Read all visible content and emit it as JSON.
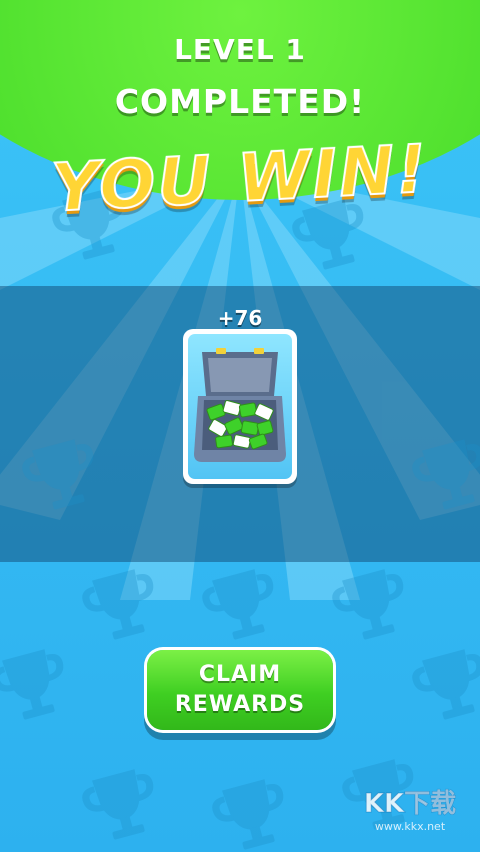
{
  "header": {
    "level_line1": "LEVEL 1",
    "level_line2": "COMPLETED!",
    "banner": "YOU WIN!"
  },
  "reward": {
    "amount": "+76",
    "icon": "cash-briefcase-icon"
  },
  "actions": {
    "claim_line1": "CLAIM",
    "claim_line2": "REWARDS"
  },
  "watermark": {
    "text": "KK下载",
    "url": "www.kkx.net"
  },
  "colors": {
    "sky": "#33b8f2",
    "cap_green": "#48dc2a",
    "banner_yellow": "#ffd535",
    "button_green": "#3fcf22"
  }
}
